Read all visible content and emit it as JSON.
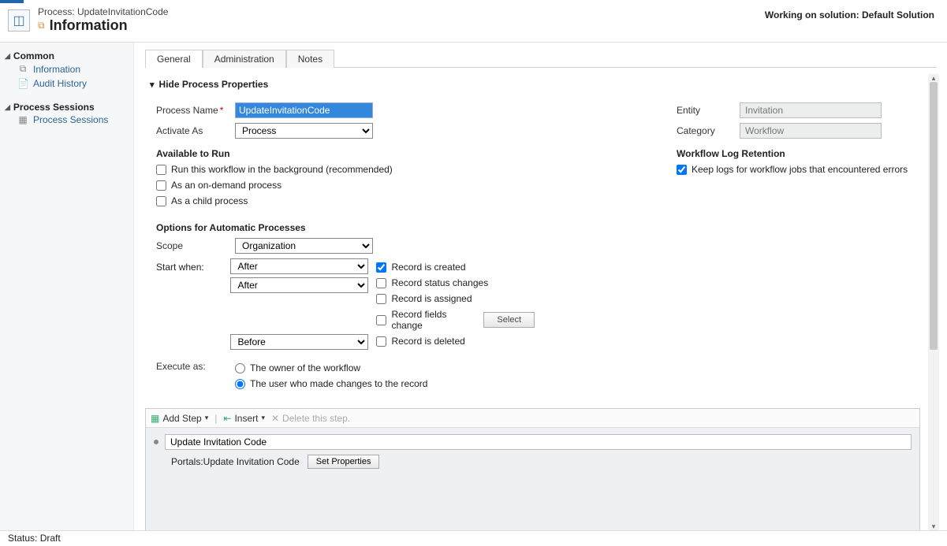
{
  "header": {
    "process_prefix": "Process: ",
    "process_name": "UpdateInvitationCode",
    "page_title": "Information",
    "solution_prefix": "Working on solution: ",
    "solution_name": "Default Solution"
  },
  "sidebar": {
    "groups": [
      {
        "title": "Common",
        "items": [
          {
            "icon": "⧉",
            "label": "Information"
          },
          {
            "icon": "📄",
            "label": "Audit History"
          }
        ]
      },
      {
        "title": "Process Sessions",
        "items": [
          {
            "icon": "▦",
            "label": "Process Sessions"
          }
        ]
      }
    ]
  },
  "tabs": [
    "General",
    "Administration",
    "Notes"
  ],
  "section_toggle": "Hide Process Properties",
  "left_col": {
    "process_name_label": "Process Name",
    "process_name_value": "UpdateInvitationCode",
    "activate_as_label": "Activate As",
    "activate_as_value": "Process",
    "available_heading": "Available to Run",
    "run_background": "Run this workflow in the background (recommended)",
    "on_demand": "As an on-demand process",
    "child_process": "As a child process",
    "options_heading": "Options for Automatic Processes",
    "scope_label": "Scope",
    "scope_value": "Organization",
    "start_when_label": "Start when:",
    "after1": "After",
    "after2": "After",
    "before": "Before",
    "created": "Record is created",
    "status_changes": "Record status changes",
    "assigned": "Record is assigned",
    "fields_change": "Record fields change",
    "select_btn": "Select",
    "deleted": "Record is deleted",
    "execute_as_label": "Execute as:",
    "exec_owner": "The owner of the workflow",
    "exec_user": "The user who made changes to the record"
  },
  "right_col": {
    "entity_label": "Entity",
    "entity_value": "Invitation",
    "category_label": "Category",
    "category_value": "Workflow",
    "log_heading": "Workflow Log Retention",
    "keep_logs": "Keep logs for workflow jobs that encountered errors"
  },
  "steps": {
    "add_step": "Add Step",
    "insert": "Insert",
    "delete": "Delete this step.",
    "description_value": "Update Invitation Code",
    "action_text": "Portals:Update Invitation Code",
    "set_properties": "Set Properties"
  },
  "statusbar": "Status: Draft"
}
